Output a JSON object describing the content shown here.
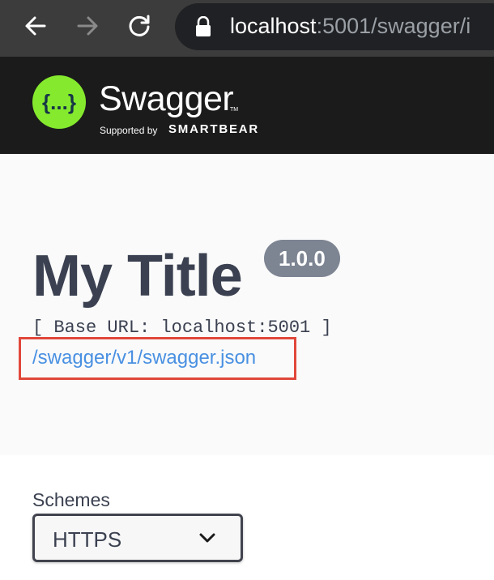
{
  "browser": {
    "url_host": "localhost",
    "url_path": ":5001/swagger/i"
  },
  "topbar": {
    "logo_icon_text": "{...}",
    "logo_text": "Swagger",
    "logo_tm": "TM",
    "supported_by": "Supported by",
    "brand": "SMARTBEAR"
  },
  "info": {
    "title": "My Title",
    "version": "1.0.0",
    "base_url": "[ Base URL: localhost:5001 ]",
    "spec_link": "/swagger/v1/swagger.json"
  },
  "schemes": {
    "label": "Schemes",
    "selected": "HTTPS"
  },
  "colors": {
    "logo_green": "#85ea2d",
    "link_blue": "#4990e2",
    "highlight_red": "#e0473a",
    "title_text": "#3b4151",
    "version_badge": "#7d8492"
  },
  "icons": {
    "back": "arrow-left-icon",
    "forward": "arrow-right-icon",
    "reload": "reload-icon",
    "lock": "lock-icon",
    "select": "chevron-down-icon"
  }
}
